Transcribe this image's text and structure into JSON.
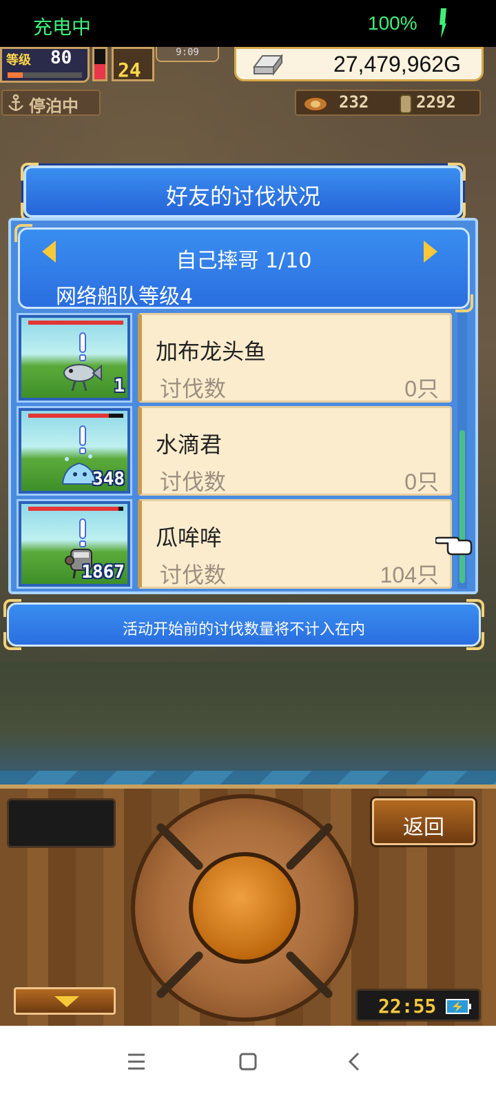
{
  "status_bar": {
    "left_text": "充电中",
    "battery_text": "100%"
  },
  "hud": {
    "level_label": "等级",
    "level_value": "80",
    "level_progress": 0.2,
    "hp_level": 0.5,
    "days_value": "24",
    "time_value": "9:09",
    "gold_value": "27,479,962G",
    "docked_label": "停泊中",
    "resource_1": "232",
    "resource_2": "2292"
  },
  "dialog": {
    "title": "好友的讨伐状况",
    "friend_name": "自己摔哥 1/10",
    "fleet_level": "网络船队等级4",
    "kill_label": "讨伐数",
    "monsters": [
      {
        "name": "加布龙头鱼",
        "kills": "0只",
        "count": "1",
        "hp": 1.0
      },
      {
        "name": "水滴君",
        "kills": "0只",
        "count": "348",
        "hp": 0.85
      },
      {
        "name": "瓜哞哞",
        "kills": "104只",
        "count": "1867",
        "hp": 0.95
      }
    ],
    "notice": "活动开始前的讨伐数量将不计入在内"
  },
  "controls": {
    "back_label": "返回",
    "clock": "22:55"
  },
  "colors": {
    "dialog_blue": "#2a6ee0",
    "card_cream": "#fbeccd",
    "status_green": "#3ef07a",
    "gold_yellow": "#f7c838"
  }
}
